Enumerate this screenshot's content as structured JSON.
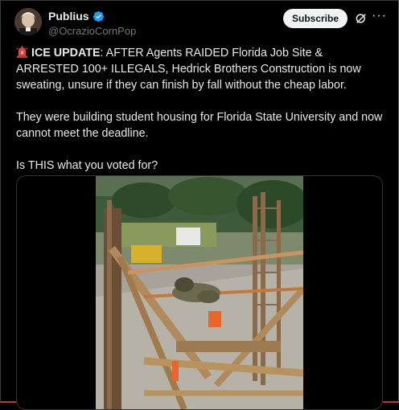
{
  "post": {
    "author_name": "Publius",
    "handle": "@OcrazioCornPop",
    "subscribe_label": "Subscribe",
    "more_label": "···",
    "lead_bold": "ICE UPDATE",
    "lead_rest": ": AFTER Agents RAIDED Florida Job Site & ARRESTED 100+ ILLEGALS, Hedrick Brothers Construction is now sweating, unsure if they can finish by fall without the cheap labor.",
    "paragraph2": "They were building student housing for Florida State University and now cannot meet the deadline.",
    "paragraph3": "Is THIS what you voted for?"
  },
  "icons": {
    "verified": "verified-badge-icon",
    "grok": "grok-icon",
    "siren": "siren-icon"
  },
  "colors": {
    "background": "#000000",
    "text": "#e7e9ea",
    "secondary": "#71767b",
    "verified": "#1d9bf0",
    "button": "#eff3f4"
  }
}
